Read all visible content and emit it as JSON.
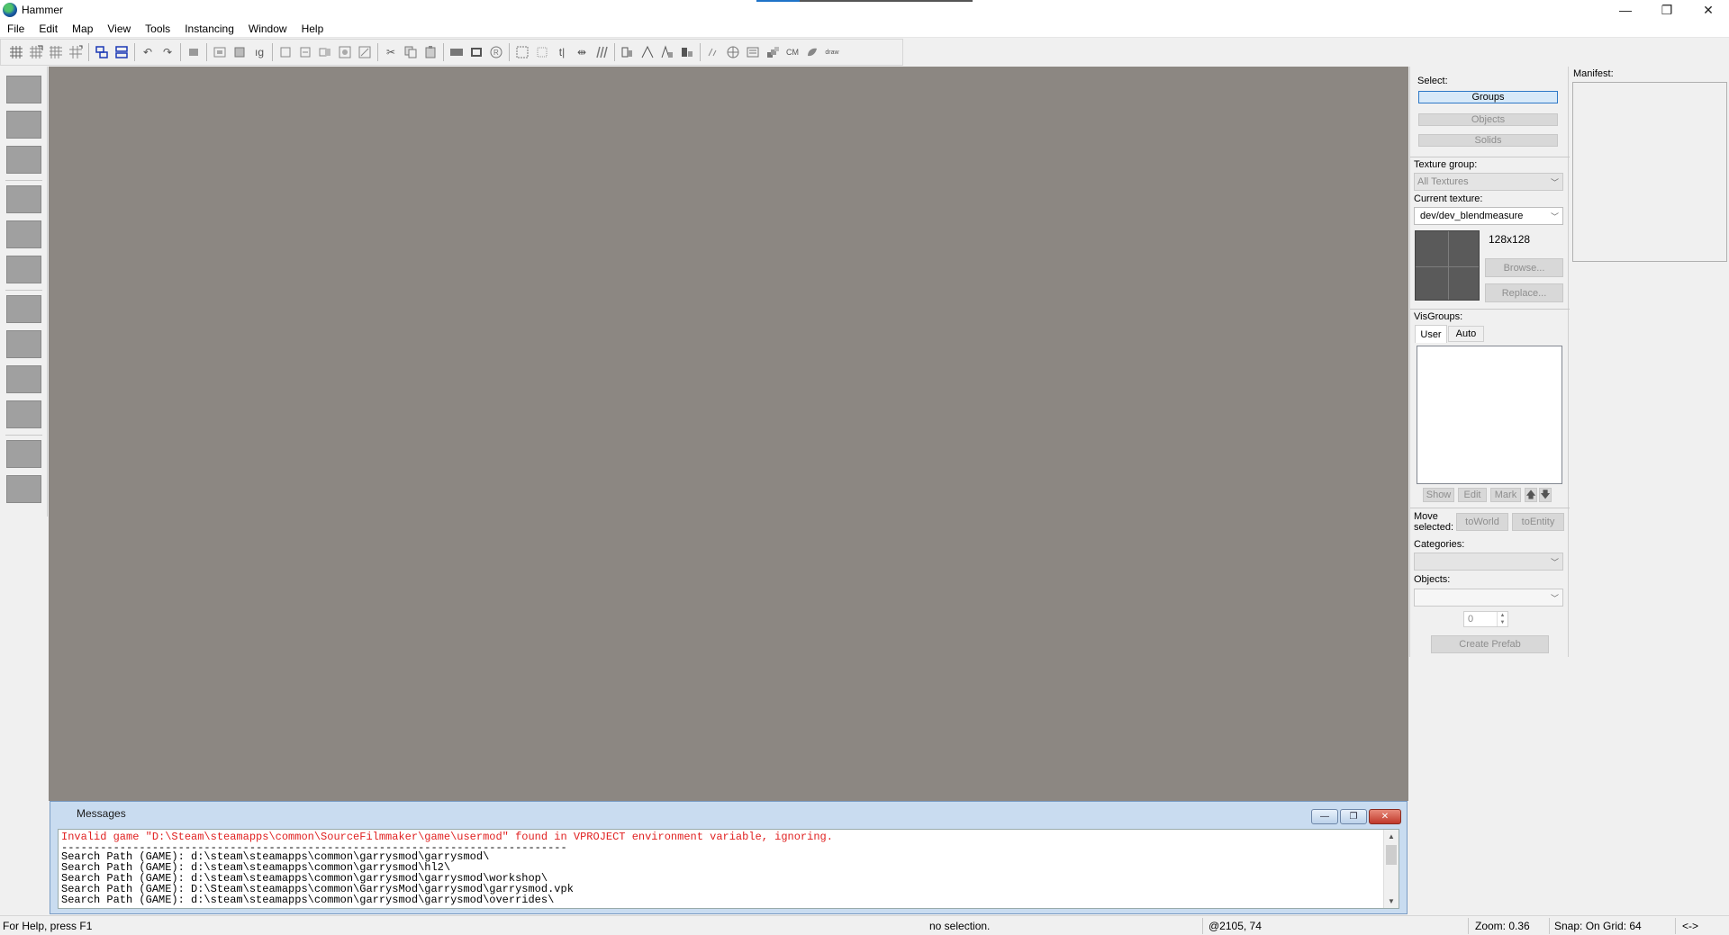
{
  "window": {
    "title": "Hammer",
    "btn_minimize": "—",
    "btn_maximize": "❐",
    "btn_close": "✕"
  },
  "menu": [
    "File",
    "Edit",
    "Map",
    "View",
    "Tools",
    "Instancing",
    "Window",
    "Help"
  ],
  "toolbar": {
    "cm_label": "CM",
    "draw_label": "draw"
  },
  "messages": {
    "title": "Messages",
    "lines": [
      {
        "text": "Invalid game \"D:\\Steam\\steamapps\\common\\SourceFilmmaker\\game\\usermod\" found in VPROJECT environment variable, ignoring.",
        "kind": "error"
      },
      {
        "text": "------------------------------------------------------------------------------",
        "kind": "dash"
      },
      {
        "text": "Search Path (GAME): d:\\steam\\steamapps\\common\\garrysmod\\garrysmod\\",
        "kind": "normal"
      },
      {
        "text": "Search Path (GAME): d:\\steam\\steamapps\\common\\garrysmod\\hl2\\",
        "kind": "normal"
      },
      {
        "text": "Search Path (GAME): d:\\steam\\steamapps\\common\\garrysmod\\garrysmod\\workshop\\",
        "kind": "normal"
      },
      {
        "text": "Search Path (GAME): D:\\Steam\\steamapps\\common\\GarrysMod\\garrysmod\\garrysmod.vpk",
        "kind": "normal"
      },
      {
        "text": "Search Path (GAME): d:\\steam\\steamapps\\common\\garrysmod\\garrysmod\\overrides\\",
        "kind": "normal"
      }
    ]
  },
  "status": {
    "help": "For Help, press F1",
    "selection": "no selection.",
    "coords": "@2105, 74",
    "zoom": "Zoom: 0.36",
    "snap": "Snap: On Grid: 64",
    "arrows": "<->"
  },
  "panel": {
    "select_label": "Select:",
    "groups": "Groups",
    "objects_btn": "Objects",
    "solids": "Solids",
    "texture_group_label": "Texture group:",
    "texture_group_value": "All Textures",
    "current_texture_label": "Current texture:",
    "current_texture_value": "dev/dev_blendmeasure",
    "texture_size": "128x128",
    "browse": "Browse...",
    "replace": "Replace...",
    "visgroups_label": "VisGroups:",
    "tab_user": "User",
    "tab_auto": "Auto",
    "show": "Show",
    "edit": "Edit",
    "mark": "Mark",
    "up": "🡅",
    "down": "🡇",
    "move_selected_line1": "Move",
    "move_selected_line2": "selected:",
    "to_world": "toWorld",
    "to_entity": "toEntity",
    "categories_label": "Categories:",
    "objects_label": "Objects:",
    "count_value": "0",
    "create_prefab": "Create Prefab"
  },
  "manifest": {
    "label": "Manifest:"
  }
}
